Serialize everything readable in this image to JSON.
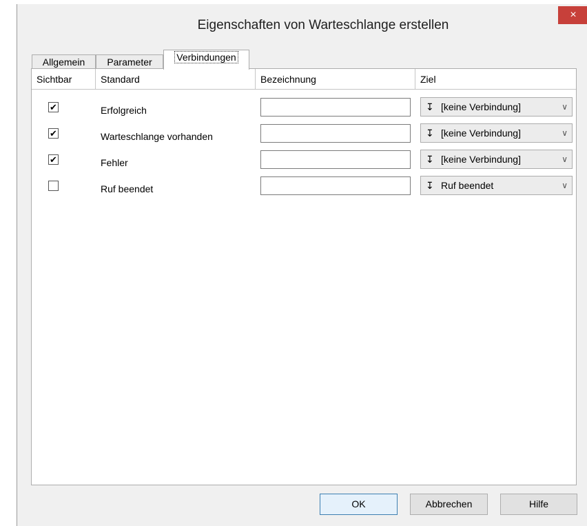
{
  "window": {
    "title": "Eigenschaften von Warteschlange erstellen",
    "close_glyph": "×"
  },
  "tabs": [
    {
      "label": "Allgemein"
    },
    {
      "label": "Parameter"
    },
    {
      "label": "Verbindungen",
      "active": true
    }
  ],
  "table": {
    "headers": [
      "Sichtbar",
      "Standard",
      "Bezeichnung",
      "Ziel"
    ],
    "rows": [
      {
        "visible": true,
        "check": "✔",
        "standard": "Erfolgreich",
        "bezeichnung": "",
        "ziel": "[keine Verbindung]"
      },
      {
        "visible": true,
        "check": "✔",
        "standard": "Warteschlange vorhanden",
        "bezeichnung": "",
        "ziel": "[keine Verbindung]"
      },
      {
        "visible": true,
        "check": "✔",
        "standard": "Fehler",
        "bezeichnung": "",
        "ziel": "[keine Verbindung]"
      },
      {
        "visible": false,
        "check": "",
        "standard": "Ruf beendet",
        "bezeichnung": "",
        "ziel": "Ruf beendet"
      }
    ],
    "target_icon": "connection-target-icon",
    "target_glyph": "↧",
    "dropdown_glyph": "∨"
  },
  "buttons": {
    "ok": "OK",
    "cancel": "Abbrechen",
    "help": "Hilfe"
  },
  "colors": {
    "close_button": "#c7403a",
    "default_button_border": "#3c7fb1"
  }
}
